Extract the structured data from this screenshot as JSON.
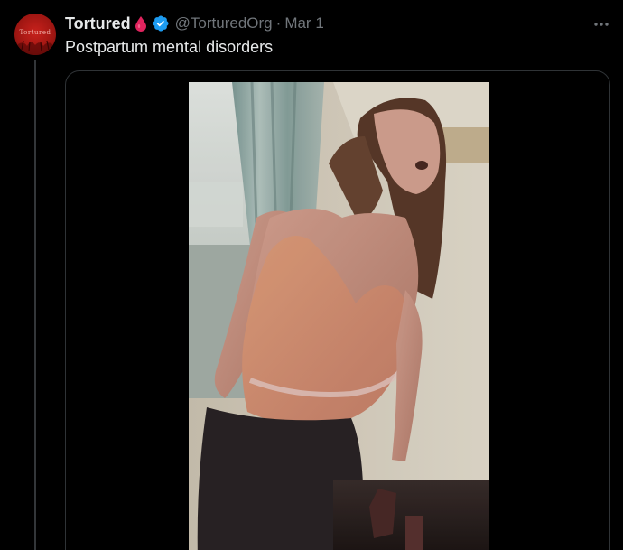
{
  "tweet": {
    "avatar_text": "Tortured",
    "display_name": "Tortured",
    "name_emoji": "drop-of-blood",
    "verified": true,
    "handle": "@TorturedOrg",
    "separator": "·",
    "date": "Mar 1",
    "text": "Postpartum mental disorders"
  },
  "colors": {
    "background": "#000000",
    "primary_text": "#e7e9ea",
    "secondary_text": "#71767b",
    "verified_blue": "#1d9bf0",
    "blood_red": "#e0245e",
    "avatar_red": "#b01a15",
    "border": "#2f3336"
  },
  "icons": {
    "more": "more-horizontal-icon",
    "verified": "verified-badge-icon",
    "emoji": "drop-of-blood-icon"
  },
  "media": {
    "type": "video"
  }
}
